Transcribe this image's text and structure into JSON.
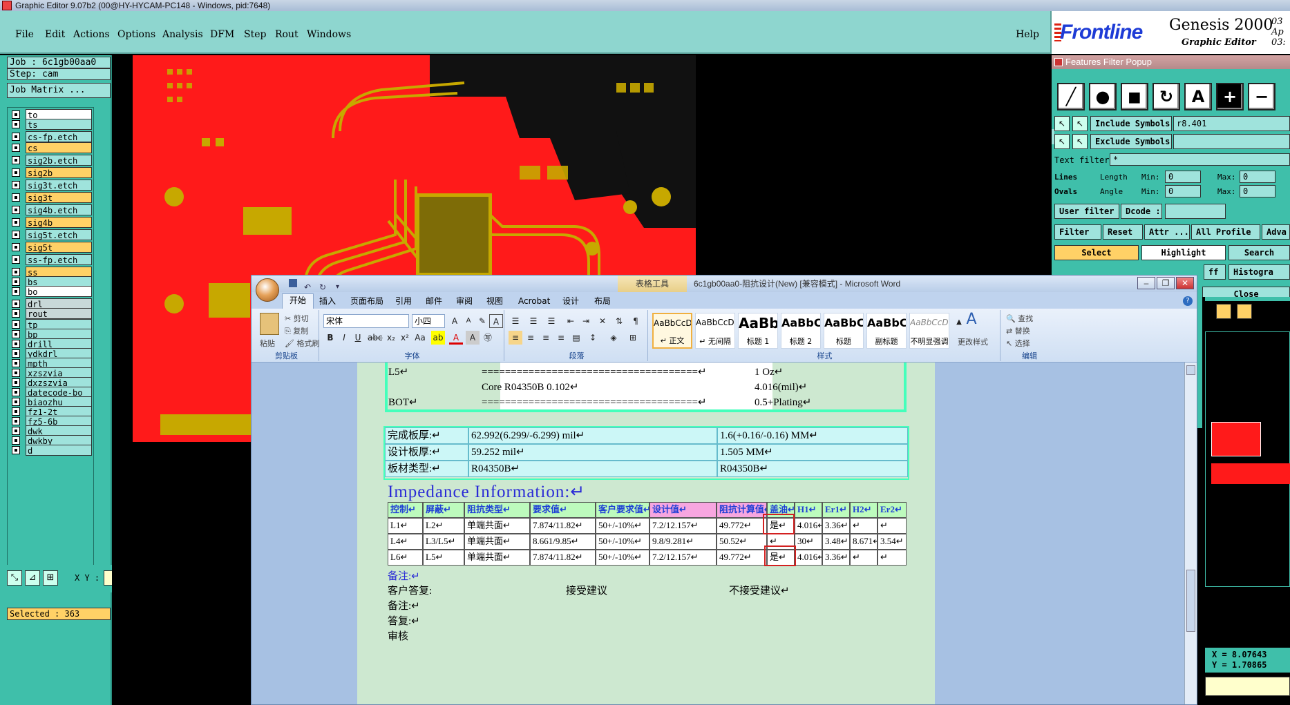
{
  "genesis": {
    "title": "Graphic Editor 9.07b2 (00@HY-HYCAM-PC148 - Windows, pid:7648)",
    "menu": [
      "File",
      "Edit",
      "Actions",
      "Options",
      "Analysis",
      "DFM",
      "Step",
      "Rout",
      "Windows"
    ],
    "help": "Help",
    "logo": {
      "brand": "Frontline",
      "product": "Genesis 2000",
      "subtitle": "Graphic Editor",
      "date_line1": "03 Ap",
      "date_line2": "03:"
    },
    "job": "Job : 6c1gb00aa0",
    "step": "Step: cam",
    "job_matrix": "Job Matrix ...",
    "layers": [
      {
        "name": "to",
        "color": "white"
      },
      {
        "name": "ts",
        "color": "board"
      },
      {
        "name": "cs-fp.etch",
        "color": "board"
      },
      {
        "name": "cs",
        "color": "sig"
      },
      {
        "name": "sig2b.etch",
        "color": "board"
      },
      {
        "name": "sig2b",
        "color": "sig"
      },
      {
        "name": "sig3t.etch",
        "color": "board"
      },
      {
        "name": "sig3t",
        "color": "sig"
      },
      {
        "name": "sig4b.etch",
        "color": "board"
      },
      {
        "name": "sig4b",
        "color": "sig"
      },
      {
        "name": "sig5t.etch",
        "color": "board"
      },
      {
        "name": "sig5t",
        "color": "sig"
      },
      {
        "name": "ss-fp.etch",
        "color": "board"
      },
      {
        "name": "ss",
        "color": "sig"
      },
      {
        "name": "bs",
        "color": "board"
      },
      {
        "name": "bo",
        "color": "white"
      },
      {
        "name": "drl",
        "color": "grey"
      },
      {
        "name": "rout",
        "color": "grey"
      },
      {
        "name": "tp",
        "color": "board"
      },
      {
        "name": "bp",
        "color": "board"
      },
      {
        "name": "drill",
        "color": "board"
      },
      {
        "name": "ydkdrl",
        "color": "board"
      },
      {
        "name": "mpth",
        "color": "board"
      },
      {
        "name": "xzszvia",
        "color": "board"
      },
      {
        "name": "dxzszvia",
        "color": "board"
      },
      {
        "name": "datecode-bo",
        "color": "board"
      },
      {
        "name": "biaozhu",
        "color": "board"
      },
      {
        "name": "fz1-2t",
        "color": "board"
      },
      {
        "name": "fz5-6b",
        "color": "board"
      },
      {
        "name": "dwk",
        "color": "board"
      },
      {
        "name": "dwkby",
        "color": "board"
      },
      {
        "name": "d",
        "color": "board"
      }
    ],
    "selected": "Selected : 363",
    "xy_label": "X Y :",
    "coords": {
      "x": "X = 8.07643",
      "y": "Y = 1.70865"
    },
    "colors": {
      "panel": "#3fbfaa",
      "menubar": "#8ed6cf",
      "layer_sig": "#ffd166",
      "pcb_copper": "#ff1a1a"
    }
  },
  "filter_popup": {
    "title": "Features Filter Popup",
    "include_symbols": "Include Symbols :",
    "include_value": "r8.401",
    "exclude_symbols": "Exclude Symbols :",
    "text_filter": "Text filter",
    "text_filter_value": "*",
    "lines": "Lines",
    "ovals": "Ovals",
    "length": "Length",
    "angle": "Angle",
    "min": "Min:",
    "max": "Max:",
    "zero": "0",
    "user_filter": "User filter ...",
    "dcode": "Dcode :",
    "filter": "Filter",
    "reset": "Reset",
    "attr": "Attr ...",
    "all_profile": "All Profile",
    "advanced": "Adva",
    "select": "Select",
    "highlight": "Highlight",
    "search": "Search",
    "histogram": "Histogra",
    "close": "Close",
    "ff": "ff"
  },
  "word": {
    "table_tools": "表格工具",
    "doc_title": "6c1gb00aa0-阻抗设计(New) [兼容模式] - Microsoft Word",
    "tabs": [
      "开始",
      "插入",
      "页面布局",
      "引用",
      "邮件",
      "审阅",
      "视图",
      "Acrobat",
      "设计",
      "布局"
    ],
    "clipboard": {
      "paste": "粘贴",
      "cut": "剪切",
      "copy": "复制",
      "format_painter": "格式刷",
      "label": "剪贴板"
    },
    "font": {
      "name": "宋体",
      "size": "小四",
      "label": "字体"
    },
    "paragraph_label": "段落",
    "styles": [
      {
        "sample": "AaBbCcDd",
        "name": "↵ 正文"
      },
      {
        "sample": "AaBbCcDd",
        "name": "↵ 无间隔"
      },
      {
        "sample": "AaBb",
        "name": "标题 1"
      },
      {
        "sample": "AaBbC",
        "name": "标题 2"
      },
      {
        "sample": "AaBbC",
        "name": "标题"
      },
      {
        "sample": "AaBbC",
        "name": "副标题"
      },
      {
        "sample": "AaBbCcDd",
        "name": "不明显强调"
      }
    ],
    "change_styles": "更改样式",
    "styles_label": "样式",
    "edit": {
      "find": "查找",
      "replace": "替换",
      "select": "选择",
      "label": "编辑"
    },
    "stackup": {
      "L5": "L5↵",
      "BOT": "BOT↵",
      "line1": "=====================================↵",
      "core": "Core      R04350B     0.102↵",
      "line2": "=====================================↵",
      "oz": "1 Oz↵",
      "mil": "4.016(mil)↵",
      "plating": "0.5+Plating↵"
    },
    "thickness_table": [
      [
        "完成板厚:↵",
        "62.992(6.299/-6.299) mil↵",
        "1.6(+0.16/-0.16) MM↵"
      ],
      [
        "设计板厚:↵",
        "59.252 mil↵",
        "1.505 MM↵"
      ],
      [
        "板材类型:↵",
        "R04350B↵",
        "R04350B↵"
      ]
    ],
    "impedance_heading": "Impedance Information:↵",
    "impedance_headers": [
      "控制↵",
      "屏蔽↵",
      "阻抗类型↵",
      "要求值↵",
      "客户要求值↵",
      "设计值↵",
      "阻抗计算值↵",
      "盖油↵",
      "H1↵",
      "Er1↵",
      "H2↵",
      "Er2↵"
    ],
    "impedance_rows": [
      [
        "L1↵",
        "L2↵",
        "单端共面↵",
        "7.874/11.82↵",
        "50+/-10%↵",
        "7.2/12.157↵",
        "49.772↵",
        "是↵",
        "4.016↵",
        "3.36↵",
        "↵",
        "↵"
      ],
      [
        "L4↵",
        "L3/L5↵",
        "单端共面↵",
        "8.661/9.85↵",
        "50+/-10%↵",
        "9.8/9.281↵",
        "50.52↵",
        "↵",
        "30↵",
        "3.48↵",
        "8.671↵",
        "3.54↵"
      ],
      [
        "L6↵",
        "L5↵",
        "单端共面↵",
        "7.874/11.82↵",
        "50+/-10%↵",
        "7.2/12.157↵",
        "49.772↵",
        "是↵",
        "4.016↵",
        "3.36↵",
        "↵",
        "↵"
      ]
    ],
    "notes": {
      "remark_label": "备注:↵",
      "customer_reply": "客户答复:",
      "accept": "接受建议",
      "reject": "不接受建议↵",
      "remark2": "备注:↵",
      "reply": "答复:↵",
      "review": "审核"
    }
  }
}
